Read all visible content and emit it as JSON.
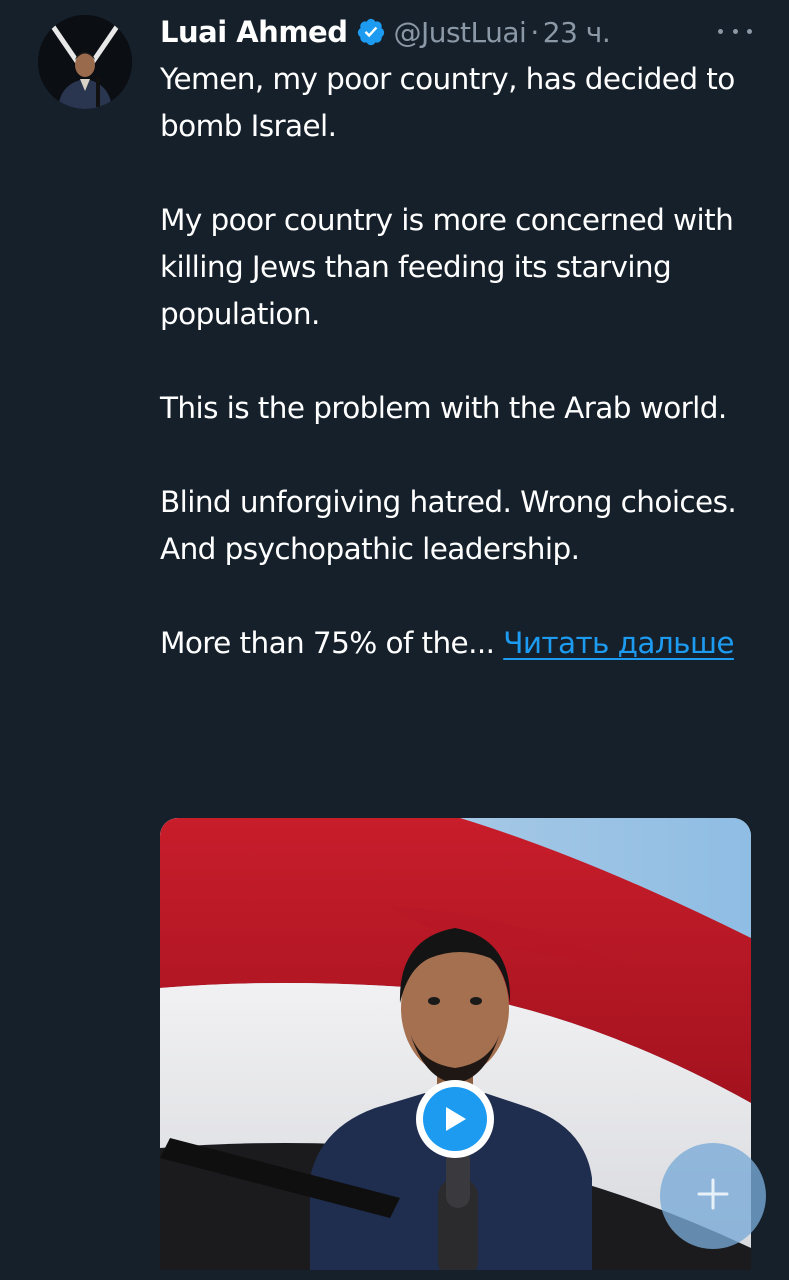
{
  "tweet": {
    "author": {
      "display_name": "Luai Ahmed",
      "handle": "@JustLuai",
      "verified_icon": "verified-badge-icon",
      "avatar_icon": "avatar"
    },
    "separator": "·",
    "timestamp": "23 ч.",
    "more_icon": "more-options-icon",
    "paragraphs": [
      "Yemen, my poor country, has decided to bomb Israel.",
      "My poor country is more concerned with killing Jews than feeding its starving population.",
      "This is the problem with the Arab world.",
      "Blind unforgiving hatred. Wrong choices. And psychopathic leadership."
    ],
    "truncated_text": "More than 75% of the...",
    "read_more_label": "Читать дальше",
    "media": {
      "type": "video",
      "play_icon": "play-icon"
    }
  },
  "compose_fab": {
    "icon": "plus-icon"
  },
  "colors": {
    "background": "#15202b",
    "accent": "#1d9bf0",
    "secondary_text": "#8b98a5"
  }
}
